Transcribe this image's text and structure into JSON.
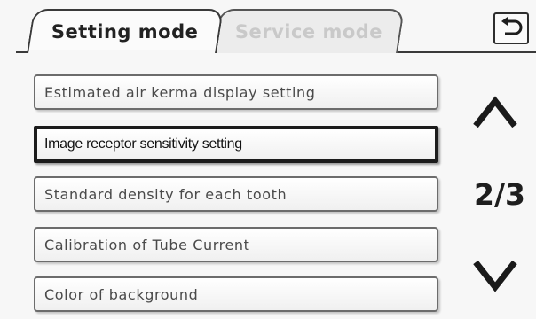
{
  "tabs": [
    {
      "label": "Setting mode",
      "active": true
    },
    {
      "label": "Service mode",
      "active": false
    }
  ],
  "header": {
    "back_icon": "return-arrow-icon"
  },
  "menu": {
    "items": [
      {
        "label": "Estimated air kerma display setting",
        "selected": false
      },
      {
        "label": "Image receptor sensitivity setting",
        "selected": true
      },
      {
        "label": "Standard density for each tooth",
        "selected": false
      },
      {
        "label": "Calibration of Tube Current",
        "selected": false
      },
      {
        "label": "Color of background",
        "selected": false
      }
    ]
  },
  "pagination": {
    "indicator": "2/3",
    "current_page": 2,
    "total_pages": 3,
    "up_icon": "chevron-up-icon",
    "down_icon": "chevron-down-icon"
  },
  "colors": {
    "active_tab_text": "#222222",
    "inactive_tab_text": "#c9c9c9",
    "selected_border": "#1c1c1c"
  }
}
